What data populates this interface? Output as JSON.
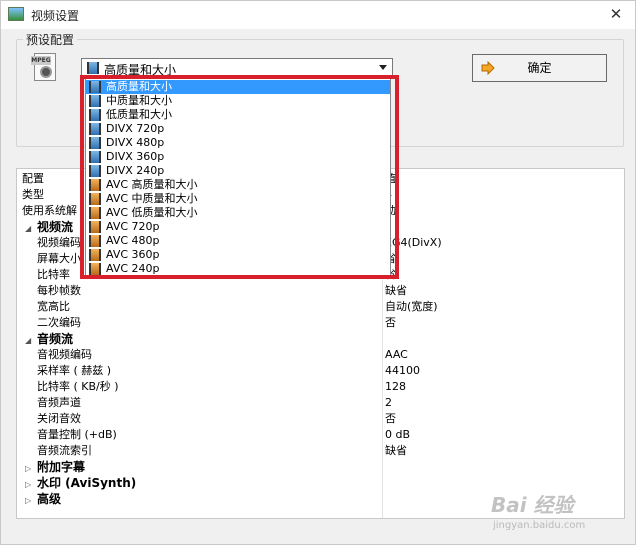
{
  "window": {
    "title": "视频设置",
    "close_glyph": "✕"
  },
  "preset": {
    "group_label": "预设配置",
    "selected_label": "高质量和大小",
    "ok_label": "确定"
  },
  "dropdown_items": [
    {
      "label": "高质量和大小",
      "icon": "film-blue-icon",
      "selected": true
    },
    {
      "label": "中质量和大小",
      "icon": "film-blue-icon",
      "selected": false
    },
    {
      "label": "低质量和大小",
      "icon": "film-blue-icon",
      "selected": false
    },
    {
      "label": "DIVX 720p",
      "icon": "film-blue-icon",
      "selected": false
    },
    {
      "label": "DIVX 480p",
      "icon": "film-blue-icon",
      "selected": false
    },
    {
      "label": "DIVX 360p",
      "icon": "film-blue-icon",
      "selected": false
    },
    {
      "label": "DIVX 240p",
      "icon": "film-blue-icon",
      "selected": false
    },
    {
      "label": "AVC 高质量和大小",
      "icon": "film-orange-icon",
      "selected": false
    },
    {
      "label": "AVC 中质量和大小",
      "icon": "film-orange-icon",
      "selected": false
    },
    {
      "label": "AVC 低质量和大小",
      "icon": "film-orange-icon",
      "selected": false
    },
    {
      "label": "AVC 720p",
      "icon": "film-orange-icon",
      "selected": false
    },
    {
      "label": "AVC 480p",
      "icon": "film-orange-icon",
      "selected": false
    },
    {
      "label": "AVC 360p",
      "icon": "film-orange-icon",
      "selected": false
    },
    {
      "label": "AVC 240p",
      "icon": "film-orange-icon",
      "selected": false
    }
  ],
  "grid": {
    "header_key": "配置",
    "header_value": "值",
    "rows": [
      {
        "key": "类型",
        "value": "4",
        "kind": "plain"
      },
      {
        "key": "使用系统解",
        "value": "动",
        "kind": "plain"
      },
      {
        "key": "视频流",
        "value": "",
        "kind": "section"
      },
      {
        "key": "视频编码",
        "value": "EG4(DivX)",
        "kind": "sub"
      },
      {
        "key": "屏幕大小",
        "value": "省",
        "kind": "sub"
      },
      {
        "key": "比特率",
        "value": "省",
        "kind": "sub"
      },
      {
        "key": "每秒帧数",
        "value": "缺省",
        "kind": "sub"
      },
      {
        "key": "宽高比",
        "value": "自动(宽度)",
        "kind": "sub"
      },
      {
        "key": "二次编码",
        "value": "否",
        "kind": "sub"
      },
      {
        "key": "音频流",
        "value": "",
        "kind": "section"
      },
      {
        "key": "音视频编码",
        "value": "AAC",
        "kind": "sub"
      },
      {
        "key": "采样率 ( 赫兹 )",
        "value": "44100",
        "kind": "sub"
      },
      {
        "key": "比特率 ( KB/秒 )",
        "value": "128",
        "kind": "sub"
      },
      {
        "key": "音频声道",
        "value": "2",
        "kind": "sub"
      },
      {
        "key": "关闭音效",
        "value": "否",
        "kind": "sub"
      },
      {
        "key": "音量控制 (+dB)",
        "value": "0 dB",
        "kind": "sub"
      },
      {
        "key": "音频流索引",
        "value": "缺省",
        "kind": "sub"
      },
      {
        "key": "附加字幕",
        "value": "",
        "kind": "collapsed"
      },
      {
        "key": "水印 (AviSynth)",
        "value": "",
        "kind": "collapsed"
      },
      {
        "key": "高级",
        "value": "",
        "kind": "collapsed"
      }
    ]
  },
  "watermark": {
    "text": "Bai 经验",
    "sub": "jingyan.baidu.com"
  },
  "colors": {
    "highlight": "#3399ff",
    "annotation_frame": "#d8202c"
  }
}
